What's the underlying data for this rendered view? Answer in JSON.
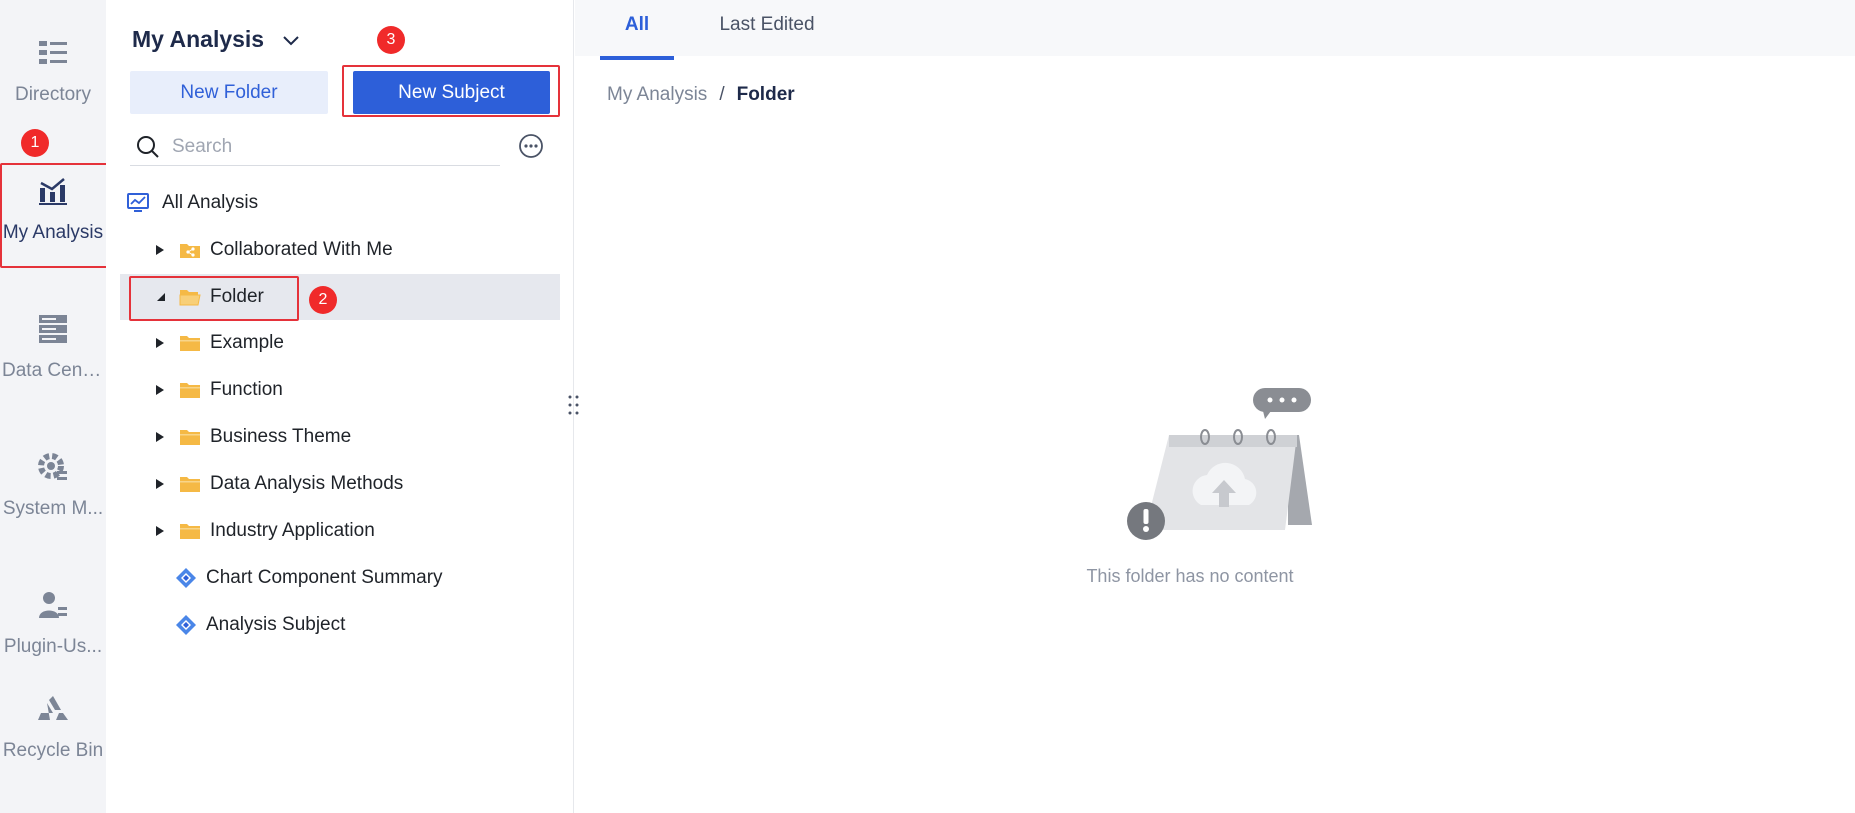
{
  "rail": {
    "items": [
      {
        "label": "Directory",
        "icon": "directory-icon"
      },
      {
        "label": "My Analysis",
        "icon": "analysis-chart-icon"
      },
      {
        "label": "Data Center",
        "icon": "database-icon"
      },
      {
        "label": "System M...",
        "icon": "gear-icon"
      },
      {
        "label": "Plugin-Us...",
        "icon": "user-plugin-icon"
      },
      {
        "label": "Recycle Bin",
        "icon": "recycle-bin-icon"
      }
    ]
  },
  "panel": {
    "title": "My Analysis",
    "new_folder_label": "New Folder",
    "new_subject_label": "New Subject",
    "search_placeholder": "Search",
    "tree": [
      {
        "label": "All Analysis",
        "type": "root"
      },
      {
        "label": "Collaborated With Me",
        "type": "shared-folder"
      },
      {
        "label": "Folder",
        "type": "folder",
        "expanded": true,
        "selected": true
      },
      {
        "label": "Example",
        "type": "folder"
      },
      {
        "label": "Function",
        "type": "folder"
      },
      {
        "label": "Business Theme",
        "type": "folder"
      },
      {
        "label": "Data Analysis Methods",
        "type": "folder"
      },
      {
        "label": "Industry Application",
        "type": "folder"
      },
      {
        "label": "Chart Component Summary",
        "type": "subject"
      },
      {
        "label": "Analysis Subject",
        "type": "subject"
      }
    ]
  },
  "annotations": {
    "badge_1": "1",
    "badge_2": "2",
    "badge_3": "3"
  },
  "main": {
    "tabs": [
      {
        "label": "All",
        "active": true
      },
      {
        "label": "Last Edited",
        "active": false
      }
    ],
    "breadcrumb": {
      "root": "My Analysis",
      "separator": "/",
      "current": "Folder"
    },
    "empty_text": "This folder has no content"
  },
  "colors": {
    "accent": "#2d5fd9",
    "highlight": "#e5323a",
    "folder": "#f5b945"
  }
}
